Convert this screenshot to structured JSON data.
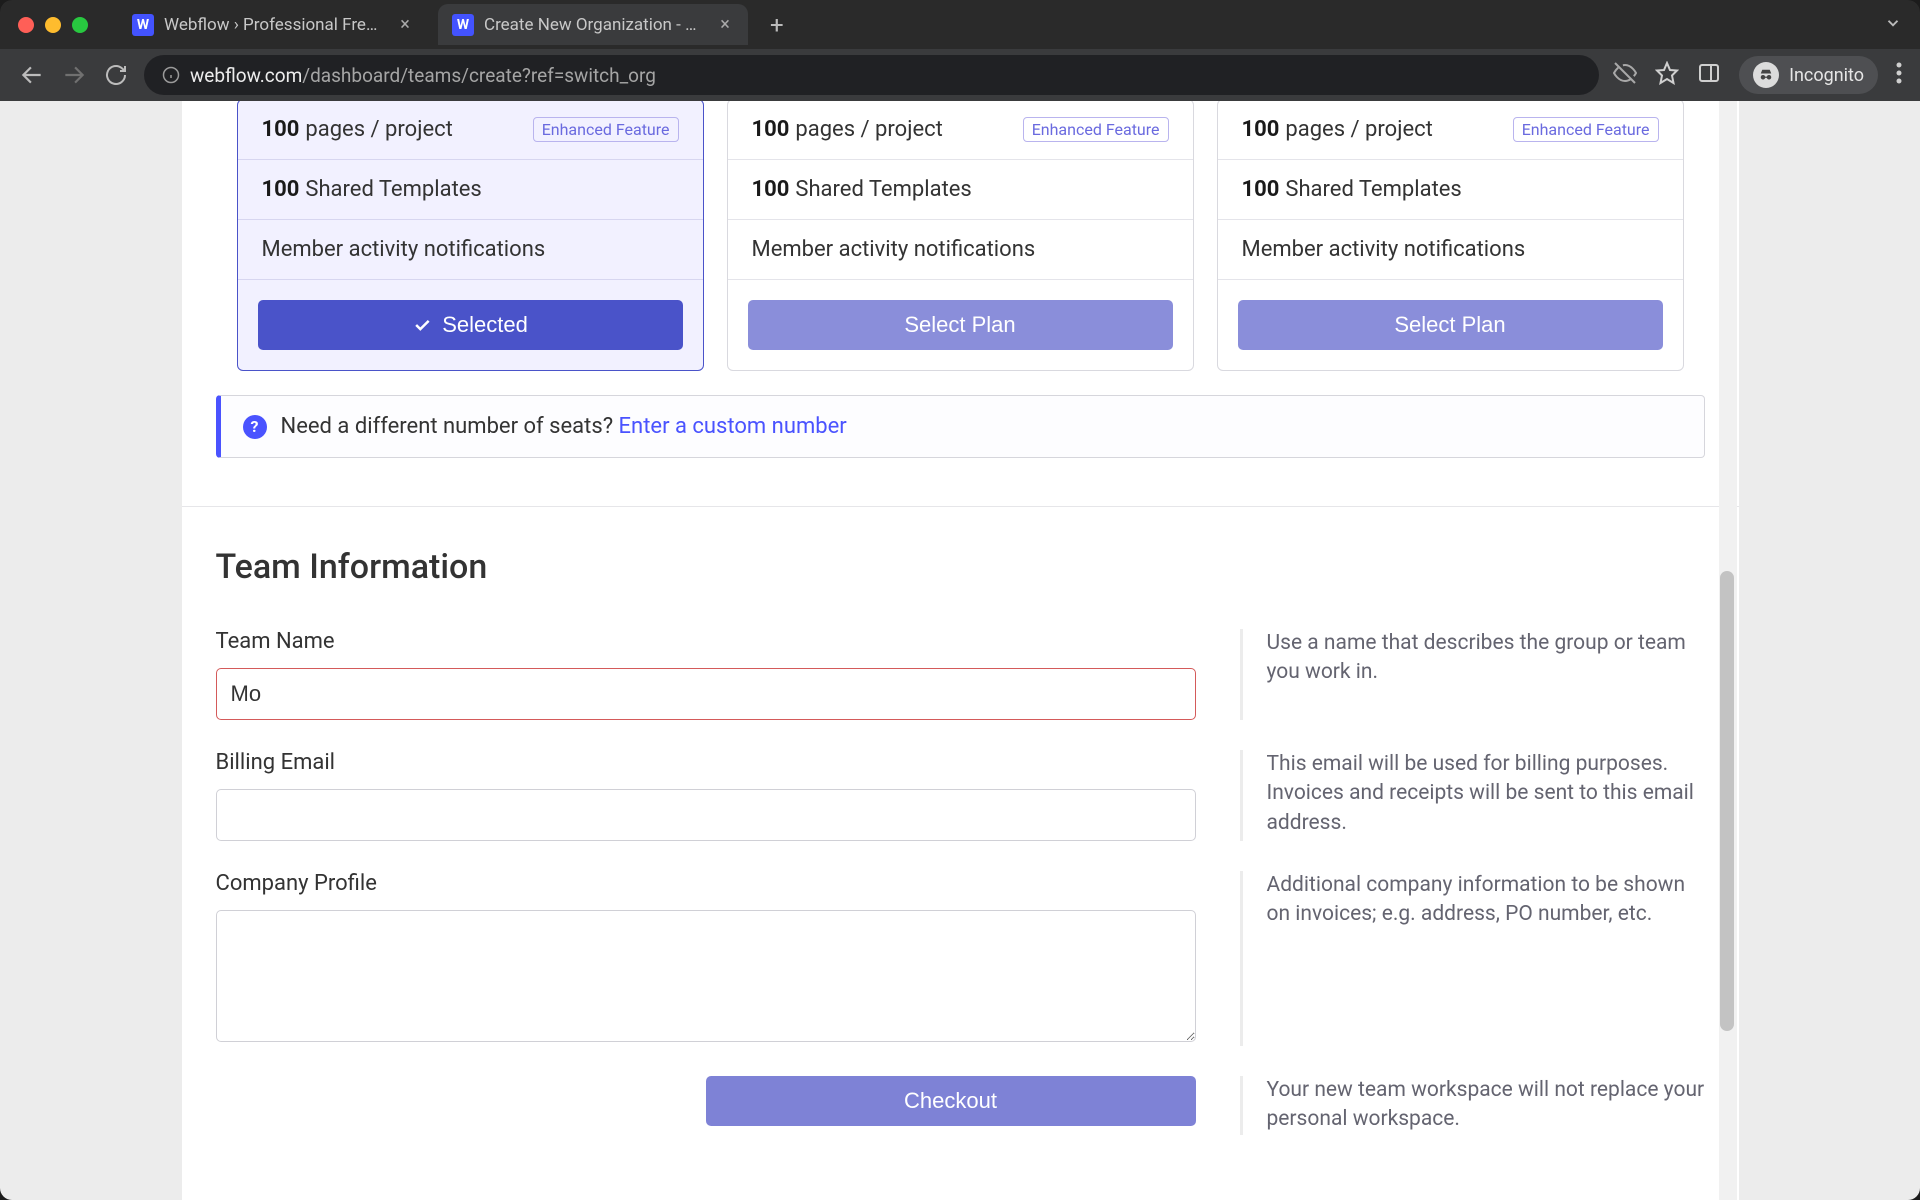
{
  "browser": {
    "tabs": [
      {
        "title": "Webflow › Professional Freelan"
      },
      {
        "title": "Create New Organization - We"
      }
    ],
    "url_host": "webflow.com",
    "url_path": "/dashboard/teams/create?ref=switch_org",
    "incognito_label": "Incognito"
  },
  "plans": {
    "features": {
      "pages_count": "100",
      "pages_label": "pages / project",
      "enhanced_badge": "Enhanced Feature",
      "templates_count": "100",
      "templates_label": "Shared Templates",
      "activity_label": "Member activity notifications"
    },
    "selected_button": "Selected",
    "select_button": "Select Plan"
  },
  "seats_banner": {
    "question": "Need a different number of seats? ",
    "link": "Enter a custom number"
  },
  "team_info": {
    "section_title": "Team Information",
    "team_name_label": "Team Name",
    "team_name_value": "Mo",
    "team_name_help": "Use a name that describes the group or team you work in.",
    "billing_email_label": "Billing Email",
    "billing_email_value": "",
    "billing_email_help": "This email will be used for billing purposes. Invoices and receipts will be sent to this email address.",
    "company_profile_label": "Company Profile",
    "company_profile_value": "",
    "company_profile_help": "Additional company information to be shown on invoices; e.g. address, PO number, etc.",
    "checkout_button": "Checkout",
    "checkout_help": "Your new team workspace will not replace your personal workspace."
  }
}
